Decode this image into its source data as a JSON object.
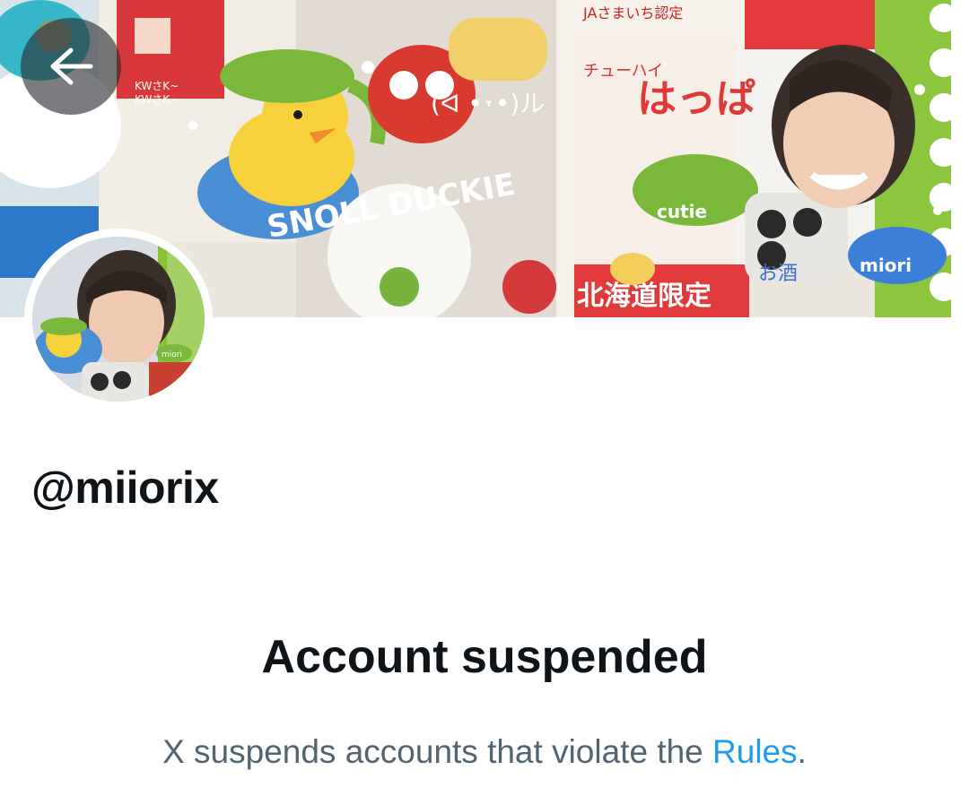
{
  "header": {
    "back_icon": "arrow-left-icon"
  },
  "banner": {
    "stickers": {
      "top_left": "KWさK~",
      "top_left_2": "KWさK~",
      "kaomoji": "(ᐛ •˕•)ル",
      "snoll_duckie": "SNOLL DUCKIE",
      "cutie": "cutie",
      "miori": "miori",
      "hokkaido": "北海道限定",
      "sake": "お酒",
      "label_top": "チューハイ",
      "label_red": "はっぱ",
      "ja": "JAさまいち認定"
    }
  },
  "profile": {
    "handle": "@miiorix",
    "avatar_sticker": "miori"
  },
  "notice": {
    "title": "Account suspended",
    "desc_prefix": "X suspends accounts that violate the ",
    "rules_link": "Rules",
    "desc_suffix": "."
  },
  "colors": {
    "text_primary": "#0f1419",
    "text_secondary": "#536471",
    "link": "#1d9bf0",
    "green_accent": "#86c232"
  }
}
